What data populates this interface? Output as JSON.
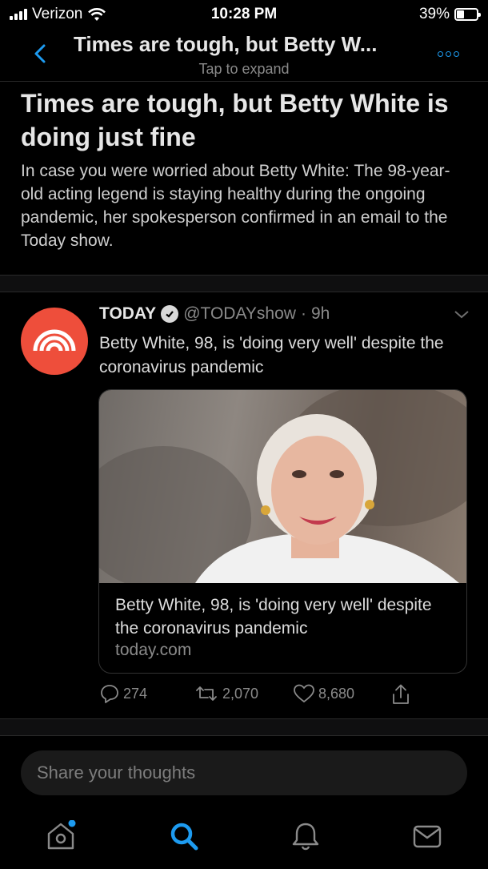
{
  "status_bar": {
    "carrier": "Verizon",
    "time": "10:28 PM",
    "battery_percent": "39%",
    "battery_level": 0.39
  },
  "header": {
    "title": "Times are tough, but Betty W...",
    "subtitle": "Tap to expand"
  },
  "moment": {
    "headline": "Times are tough, but Betty White is doing just fine",
    "summary": "In case you were worried about Betty White: The 98-year-old acting legend is staying healthy during the ongoing pandemic, her spokesperson confirmed in an email to the Today show."
  },
  "tweet": {
    "name": "TODAY",
    "handle": "@TODAYshow",
    "separator": "·",
    "time": "9h",
    "text": "Betty White, 98, is 'doing very well' despite the coronavirus pandemic",
    "card": {
      "title": "Betty White, 98, is 'doing very well' despite the coronavirus pandemic",
      "domain": "today.com"
    },
    "actions": {
      "replies": "274",
      "retweets": "2,070",
      "likes": "8,680"
    }
  },
  "compose": {
    "placeholder": "Share your thoughts"
  },
  "tabbar": {
    "items": [
      "home-icon",
      "search-icon",
      "notifications-icon",
      "messages-icon"
    ],
    "active": "search-icon"
  },
  "colors": {
    "accent": "#1d9bf0",
    "today_brand": "#ee4e3b"
  }
}
